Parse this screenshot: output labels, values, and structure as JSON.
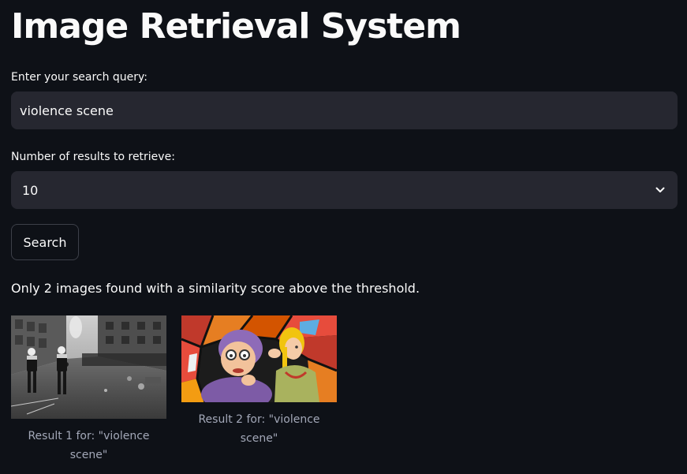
{
  "app": {
    "title": "Image Retrieval System"
  },
  "query": {
    "label": "Enter your search query:",
    "value": "violence scene"
  },
  "num_results": {
    "label": "Number of results to retrieve:",
    "selected": "10"
  },
  "search_button": {
    "label": "Search"
  },
  "status_message": "Only 2 images found with a similarity score above the threshold.",
  "results": [
    {
      "caption": "Result 1 for: \"violence scene\"",
      "image_description": "grayscale street photo"
    },
    {
      "caption": "Result 2 for: \"violence scene\"",
      "image_description": "cartoon illustration on stained glass background"
    }
  ],
  "colors": {
    "background": "#0e1117",
    "input_bg": "#262730",
    "text": "#fafafa",
    "caption": "#a3a8b8",
    "button_border": "#3d4049"
  },
  "icons": {
    "select_chevron": "chevron-down-icon"
  }
}
